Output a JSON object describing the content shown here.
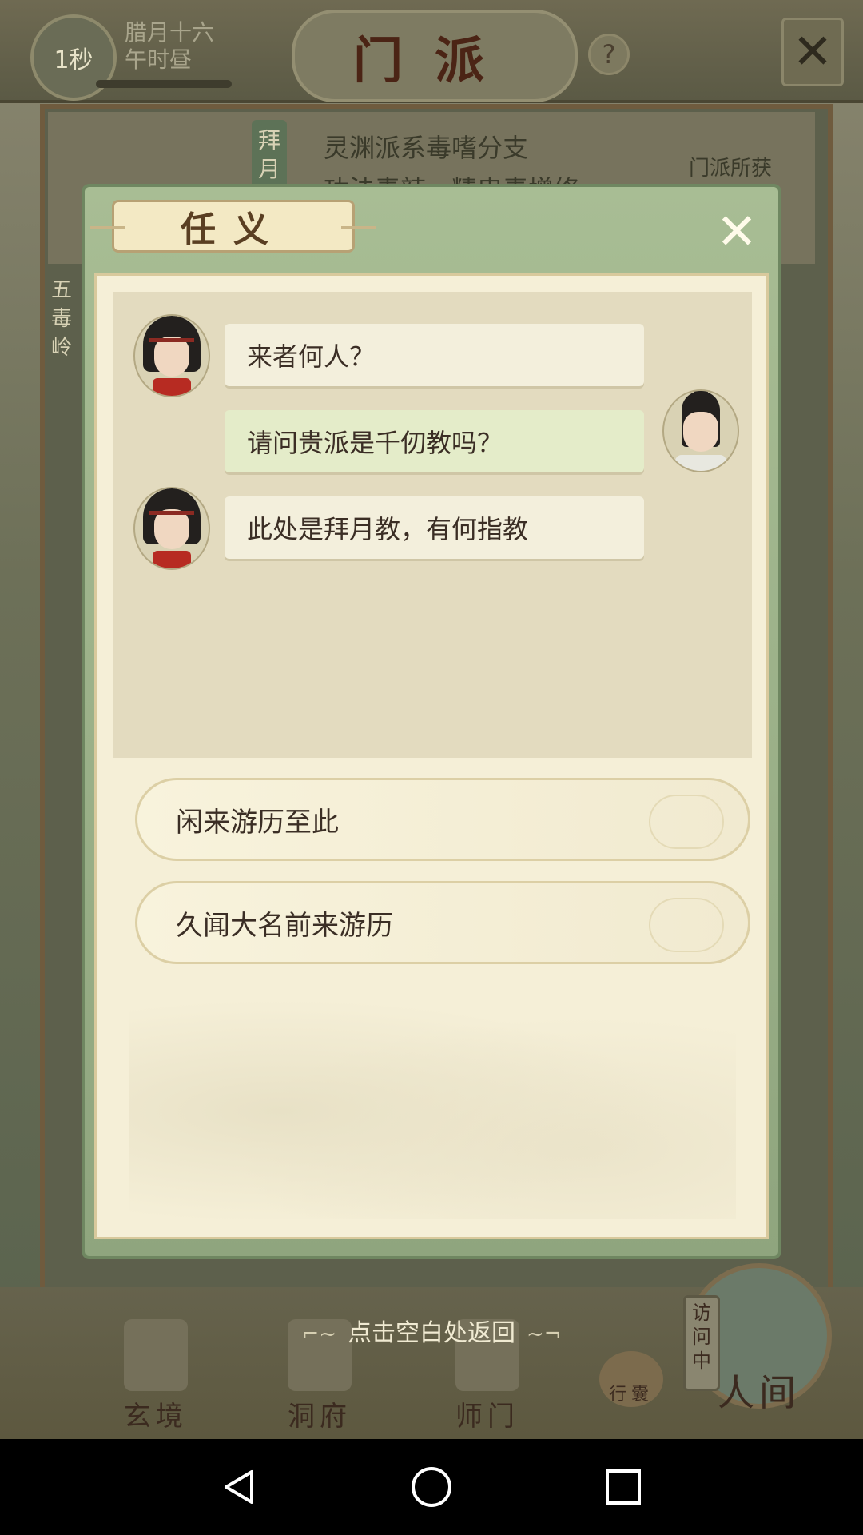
{
  "background": {
    "timer_badge": "1秒",
    "lunar_date": "腊月十六",
    "time_of_day": "午时昼",
    "sect_title": "门派",
    "help_label": "?",
    "sect_banner": "拜月",
    "sect_name": "灵渊派系毒嗜分支",
    "sect_desc_partial": "功法毒辣，精忠毒增修",
    "sect_gain": "门派所获",
    "side_label": "五毒岭",
    "tap_hint": "点击空白处返回",
    "visiting_tag": "访问中",
    "bottom_nav": [
      {
        "label": "玄境",
        "icon": "scroll-icon"
      },
      {
        "label": "洞府",
        "icon": "cave-gate-icon"
      },
      {
        "label": "师门",
        "icon": "sect-banner-icon"
      },
      {
        "label": "行囊",
        "icon": "bag-icon"
      },
      {
        "label": "人间",
        "icon": "landscape-icon"
      }
    ]
  },
  "dialog": {
    "title": "任义",
    "close_icon": "close-icon",
    "messages": [
      {
        "speaker": "npc",
        "text": "来者何人？"
      },
      {
        "speaker": "player",
        "text": "请问贵派是千仞教吗？"
      },
      {
        "speaker": "npc",
        "text": "此处是拜月教，有何指教"
      }
    ],
    "choices": [
      {
        "text": "闲来游历至此"
      },
      {
        "text": "久闻大名前来游历"
      }
    ]
  },
  "android_nav": {
    "back": "back-icon",
    "home": "home-icon",
    "recent": "recent-apps-icon"
  },
  "colors": {
    "dialog_frame": "#a8bd94",
    "dialog_body": "#f5efd7",
    "player_bubble": "#e4ecc9",
    "npc_bubble": "#f3efdc",
    "text": "#3b2e25"
  }
}
